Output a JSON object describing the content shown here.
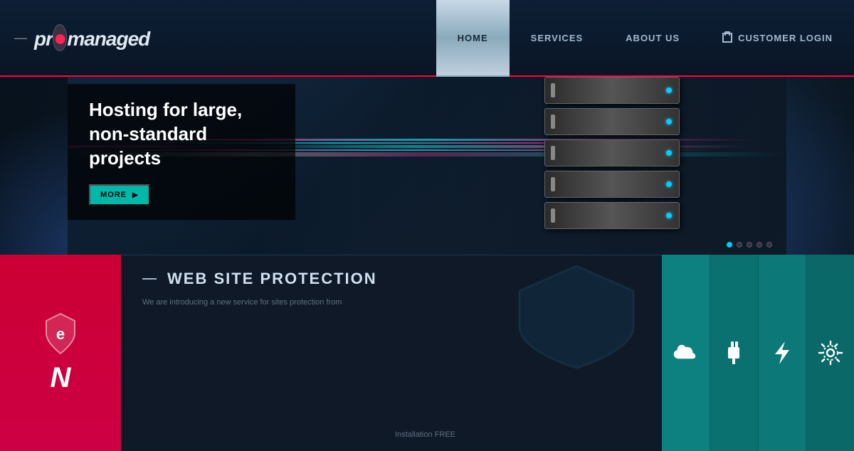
{
  "header": {
    "logo": {
      "prefix": "pr",
      "dot": "●",
      "suffix": "managed"
    },
    "nav": {
      "items": [
        {
          "label": "HOME",
          "active": true
        },
        {
          "label": "SERVICES",
          "active": false
        },
        {
          "label": "ABOUT US",
          "active": false
        },
        {
          "label": "CUSTOMER LOGIN",
          "active": false,
          "icon": "login-icon"
        }
      ]
    }
  },
  "hero": {
    "title": "Hosting for large, non-standard projects",
    "cta_label": "MORE",
    "cta_arrow": "▶",
    "slides": 5,
    "active_slide": 0
  },
  "lower": {
    "section_title": "WEB SITE PROTECTION",
    "title_dash": "—",
    "description": "We are introducing a new service for sites protection from",
    "install_label": "Installation FREE"
  },
  "features": [
    {
      "icon": "☁",
      "label": "cloud"
    },
    {
      "icon": "⚡",
      "label": "power"
    },
    {
      "icon": "⚡",
      "label": "lightning"
    },
    {
      "icon": "⚙",
      "label": "settings"
    }
  ],
  "colors": {
    "accent_cyan": "#00ccee",
    "accent_red": "#ff003c",
    "accent_teal": "#00b8aa",
    "sidebar_red": "#cc0033",
    "nav_active_bg": "#b8ccd8"
  }
}
